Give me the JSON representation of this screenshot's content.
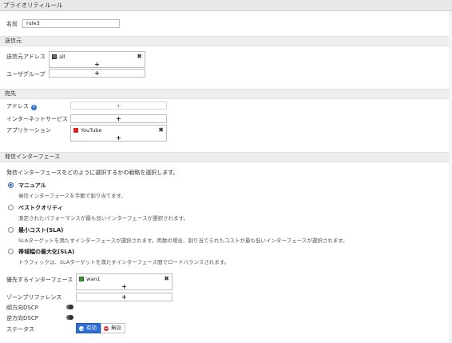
{
  "window": {
    "title": "プライオリティルール"
  },
  "name_field": {
    "label": "名前",
    "value": "rule3"
  },
  "source": {
    "section_title": "送信元",
    "address_label": "送信元アドレス",
    "address_item": "all",
    "address_add": "+",
    "address_remove": "✖",
    "user_group_label": "ユーザグループ",
    "user_group_add": "+"
  },
  "destination": {
    "section_title": "宛先",
    "address_label": "アドレス",
    "address_info": "i",
    "address_add": "+",
    "internet_service_label": "インターネットサービス",
    "internet_service_add": "+",
    "application_label": "アプリケーション",
    "application_item": "YouTube",
    "application_add": "+",
    "application_remove": "✖"
  },
  "outgoing": {
    "section_title": "発信インターフェース",
    "description": "発信インターフェースをどのように選択するかの戦略を選択します。",
    "options": [
      {
        "title": "マニュアル",
        "desc": "発信インターフェースを手動で割り当てます。",
        "checked": true
      },
      {
        "title": "ベストクオリティ",
        "desc": "測定されたパフォーマンスが最も良いインターフェースが選択されます。",
        "checked": false
      },
      {
        "title": "最小コスト(SLA)",
        "desc": "SLAターゲットを満たすインターフェースが選択されます。両数の場合、割り当てられたコストが最も低いインターフェースが選択されます。",
        "checked": false
      },
      {
        "title": "帯域幅の最大化(SLA)",
        "desc": "トラフィックは、SLAターゲットを満たすインターフェース間でロードバランスされます。",
        "checked": false
      }
    ],
    "preferred_label": "優先するインターフェース",
    "preferred_item": "wan1",
    "preferred_add": "+",
    "preferred_remove": "✖",
    "zone_label": "ゾーンプリファレンス",
    "zone_add": "+",
    "forward_dscp_label": "順方向DSCP",
    "reverse_dscp_label": "逆方向DSCP",
    "status_label": "ステータス",
    "status_enabled": "有効",
    "status_disabled": "無効"
  },
  "colors": {
    "accent": "#2f6ed2",
    "danger": "#d0312d",
    "section_bg": "#eeeeee",
    "info": "#2e6fd0"
  },
  "icons": {
    "address_item_icon": "address-object-icon",
    "application_item_icon": "youtube-icon",
    "interface_item_icon": "network-interface-icon"
  }
}
